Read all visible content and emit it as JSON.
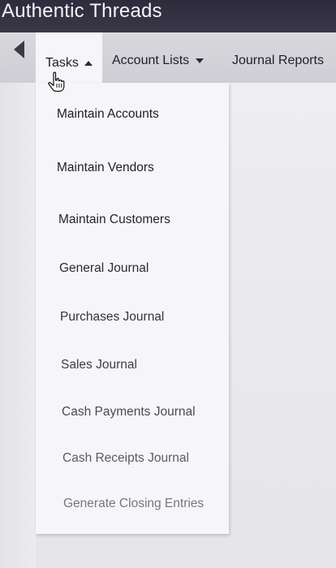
{
  "app": {
    "title": "Authentic Threads"
  },
  "navbar": {
    "tasks_label": "Tasks",
    "account_lists_label": "Account Lists",
    "journal_reports_label": "Journal Reports"
  },
  "tasks_menu": {
    "items": [
      "Maintain Accounts",
      "Maintain Vendors",
      "Maintain Customers",
      "General Journal",
      "Purchases Journal",
      "Sales Journal",
      "Cash Payments Journal",
      "Cash Receipts Journal",
      "Generate Closing Entries"
    ]
  },
  "colors": {
    "title_bar": "#2e2b3c",
    "nav_bar": "#d5d4da",
    "menu_background": "#f6f6f8",
    "text": "#1f1e26"
  },
  "icons": {
    "back": "back-arrow-icon",
    "cursor": "hand-pointer-icon",
    "tasks_caret": "caret-up-icon",
    "account_lists_caret": "caret-down-icon"
  }
}
